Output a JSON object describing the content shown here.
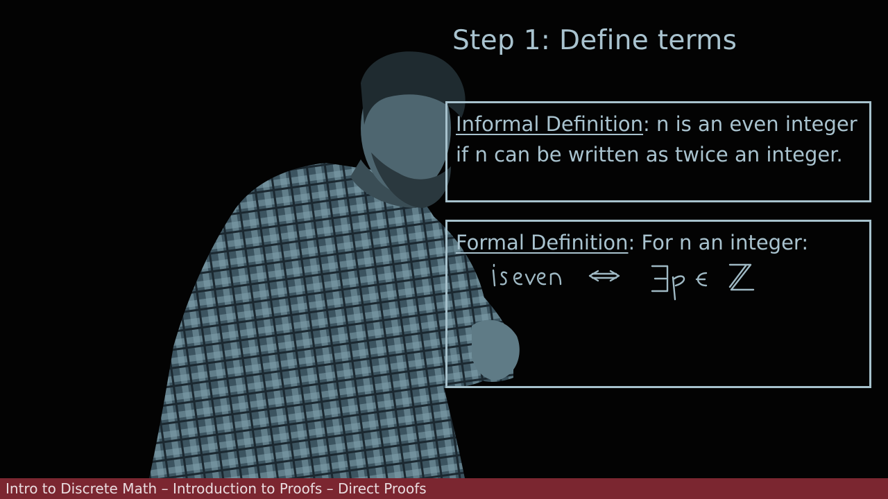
{
  "slide": {
    "title": "Step 1: Define terms",
    "informal": {
      "heading": "Informal Definition",
      "separator": ":",
      "text": " n is an even integer if n can be written as twice an integer."
    },
    "formal": {
      "heading": "Formal Definition",
      "separator": ":",
      "text": " For n an integer:"
    }
  },
  "footer": {
    "text": "Intro to Discrete Math – Introduction to Proofs – Direct Proofs"
  },
  "colors": {
    "background": "#030303",
    "text": "#a9c3cf",
    "box_border": "#a7c2cd",
    "footer_bar": "#7b2630"
  }
}
